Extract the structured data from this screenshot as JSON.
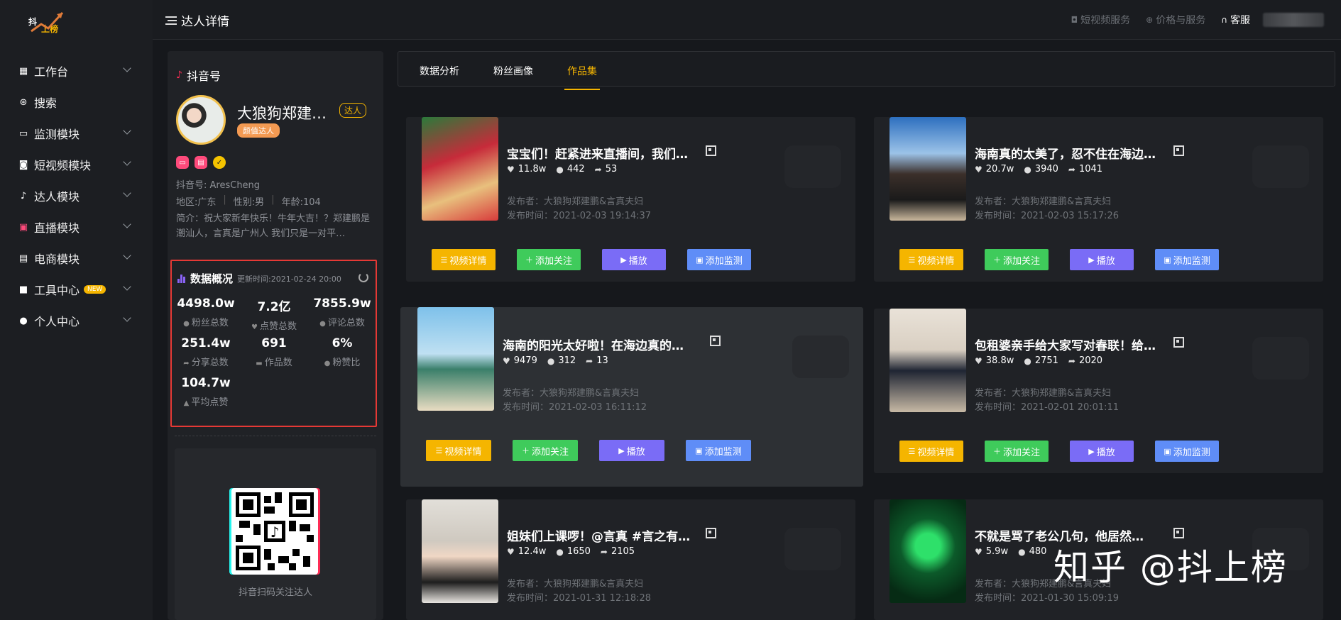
{
  "sidebar": {
    "logo": {
      "line1": "抖",
      "line2": "上榜"
    },
    "items": [
      {
        "label": "工作台",
        "icon": "grid-icon"
      },
      {
        "label": "搜索",
        "icon": "search-icon"
      },
      {
        "label": "监测模块",
        "icon": "monitor-icon"
      },
      {
        "label": "短视频模块",
        "icon": "video-icon"
      },
      {
        "label": "达人模块",
        "icon": "tiktok-icon"
      },
      {
        "label": "直播模块",
        "icon": "live-icon"
      },
      {
        "label": "电商模块",
        "icon": "shop-icon"
      },
      {
        "label": "工具中心",
        "icon": "tool-icon",
        "badge": "NEW"
      },
      {
        "label": "个人中心",
        "icon": "user-icon"
      }
    ]
  },
  "topbar": {
    "title": "达人详情",
    "links": [
      {
        "label": "短视频服务",
        "icon": "camera-icon"
      },
      {
        "label": "价格与服务",
        "icon": "yen-icon"
      },
      {
        "label": "客服",
        "icon": "headset-icon"
      }
    ]
  },
  "profile": {
    "platform": "抖音号",
    "name": "大狼狗郑建鹏&言真夫妇",
    "badge": "达人",
    "tag": "颜值达人",
    "douyin_id": "抖音号: AresCheng",
    "region": "地区:广东",
    "gender": "性别:男",
    "age": "年龄:104",
    "bio": "简介：祝大家新年快乐！牛年大吉！？郑建鹏是潮汕人，言真是广州人 我们只是一对平…"
  },
  "overview": {
    "title": "数据概况",
    "updated": "更新时间:2021-02-24 20:00",
    "stats": [
      {
        "value": "4498.0w",
        "label": "粉丝总数"
      },
      {
        "value": "7.2亿",
        "label": "点赞总数"
      },
      {
        "value": "7855.9w",
        "label": "评论总数"
      },
      {
        "value": "251.4w",
        "label": "分享总数"
      },
      {
        "value": "691",
        "label": "作品数"
      },
      {
        "value": "6%",
        "label": "粉赞比"
      },
      {
        "value": "104.7w",
        "label": "平均点赞"
      }
    ]
  },
  "qr": {
    "caption": "抖音扫码关注达人"
  },
  "tabs": [
    {
      "label": "数据分析",
      "active": false
    },
    {
      "label": "粉丝画像",
      "active": false
    },
    {
      "label": "作品集",
      "active": true
    }
  ],
  "buttons": {
    "detail": "视频详情",
    "follow": "添加关注",
    "play": "播放",
    "monitor": "添加监测"
  },
  "videos": [
    {
      "title": "宝宝们！赶紧进来直播间，我们…",
      "likes": "11.8w",
      "comments": "442",
      "shares": "53",
      "publisher": "发布者：大狼狗郑建鹏&言真夫妇",
      "time": "发布时间：2021-02-03 19:14:37"
    },
    {
      "title": "海南真的太美了，忍不住在海边…",
      "likes": "20.7w",
      "comments": "3940",
      "shares": "1041",
      "publisher": "发布者：大狼狗郑建鹏&言真夫妇",
      "time": "发布时间：2021-02-03 15:17:26"
    },
    {
      "title": "海南的阳光太好啦！在海边真的…",
      "likes": "9479",
      "comments": "312",
      "shares": "13",
      "publisher": "发布者：大狼狗郑建鹏&言真夫妇",
      "time": "发布时间：2021-02-03 16:11:12"
    },
    {
      "title": "包租婆亲手给大家写对春联！给…",
      "likes": "38.8w",
      "comments": "2751",
      "shares": "2020",
      "publisher": "发布者：大狼狗郑建鹏&言真夫妇",
      "time": "发布时间：2021-02-01 20:01:11"
    },
    {
      "title": "姐妹们上课啰！@言真 #言之有…",
      "likes": "12.4w",
      "comments": "1650",
      "shares": "2105",
      "publisher": "发布者：大狼狗郑建鹏&言真夫妇",
      "time": "发布时间：2021-01-31 12:18:28"
    },
    {
      "title": "不就是骂了老公几句，他居然…",
      "likes": "5.9w",
      "comments": "480",
      "shares": "",
      "publisher": "发布者：大狼狗郑建鹏&言真夫妇",
      "time": "发布时间：2021-01-30 15:09:19"
    }
  ],
  "watermark": "知乎 @抖上榜"
}
